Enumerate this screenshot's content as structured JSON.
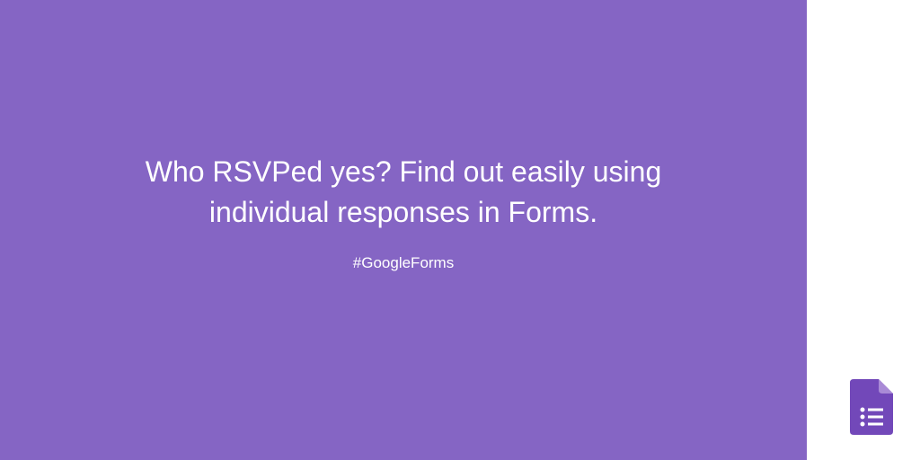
{
  "main": {
    "headline": "Who RSVPed yes? Find out easily using individual responses in Forms.",
    "hashtag": "#GoogleForms"
  },
  "colors": {
    "panel_bg": "#8565c4",
    "icon_fill": "#7248b9",
    "icon_fold": "#a98ad6"
  }
}
